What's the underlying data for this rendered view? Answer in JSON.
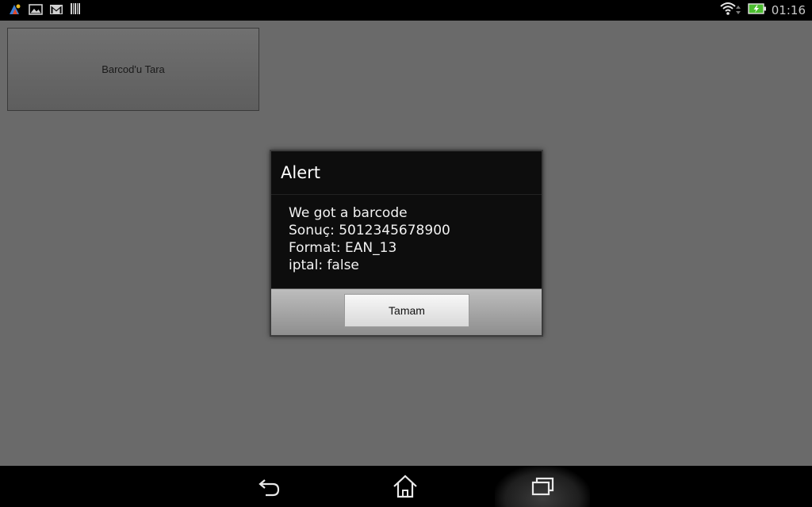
{
  "status_bar": {
    "clock": "01:16",
    "left_icons": [
      "paint-notification-icon",
      "image-icon",
      "gmail-icon",
      "barcode-icon"
    ],
    "right_icons": [
      "wifi-icon",
      "battery-charging-icon"
    ]
  },
  "app": {
    "scan_button_label": "Barcod'u Tara"
  },
  "dialog": {
    "title": "Alert",
    "lines": [
      "We got a barcode",
      "Sonuç: 5012345678900",
      "Format: EAN_13",
      "iptal: false"
    ],
    "ok_label": "Tamam"
  },
  "nav_bar": {
    "icons": [
      "back-icon",
      "home-icon",
      "recent-apps-icon"
    ]
  },
  "colors": {
    "screen_background": "#6a6a6a",
    "dialog_background": "#0d0d0d",
    "battery_green": "#4bbd2f"
  }
}
